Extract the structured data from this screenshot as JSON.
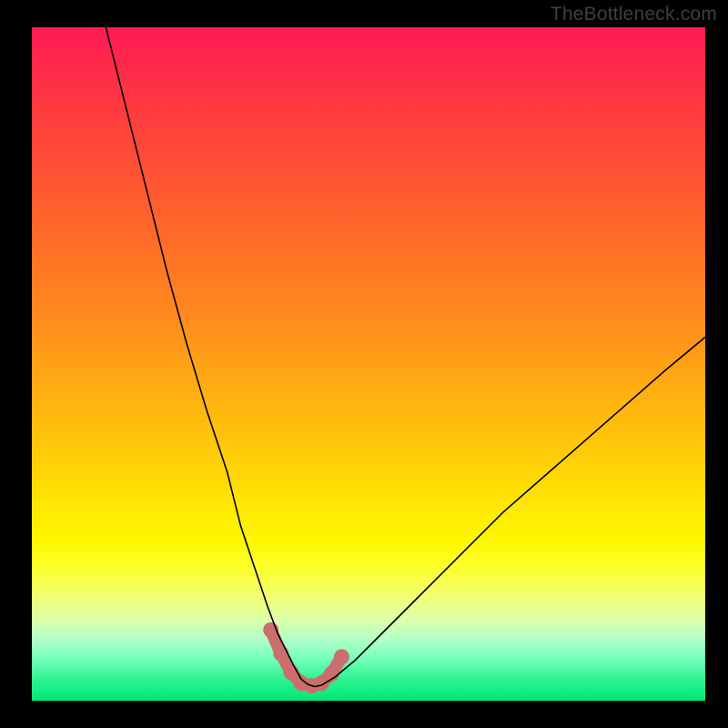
{
  "watermark": "TheBottleneck.com",
  "colors": {
    "frame": "#000000",
    "curve": "#000000",
    "markers": "#cc6e6e",
    "gradient_top": "#ff1a55",
    "gradient_bottom": "#00e876"
  },
  "chart_data": {
    "type": "line",
    "title": "",
    "xlabel": "",
    "ylabel": "",
    "xlim": [
      0,
      100
    ],
    "ylim": [
      0,
      100
    ],
    "grid": false,
    "legend": false,
    "background": "heatmap-gradient-vertical",
    "series": [
      {
        "name": "bottleneck-curve",
        "x": [
          11,
          14,
          17,
          20,
          23,
          26,
          29,
          31,
          33,
          35,
          36.5,
          38,
          39,
          40,
          41,
          42,
          43,
          45,
          48,
          52,
          57,
          63,
          70,
          78,
          86,
          94,
          100
        ],
        "y": [
          100,
          88,
          76,
          64,
          53,
          43,
          34,
          26,
          20,
          14,
          10,
          7,
          5,
          3.2,
          2.4,
          2.1,
          2.3,
          3.5,
          6,
          10,
          15,
          21,
          28,
          35,
          42,
          49,
          54
        ]
      }
    ],
    "markers": {
      "name": "optimum-zone",
      "style": "thick-pink-band-with-dots",
      "x": [
        35.5,
        37,
        38.5,
        40,
        41.5,
        43,
        44.5,
        46
      ],
      "y": [
        10.5,
        7,
        4.2,
        2.6,
        2.2,
        2.6,
        4.0,
        6.5
      ]
    }
  }
}
